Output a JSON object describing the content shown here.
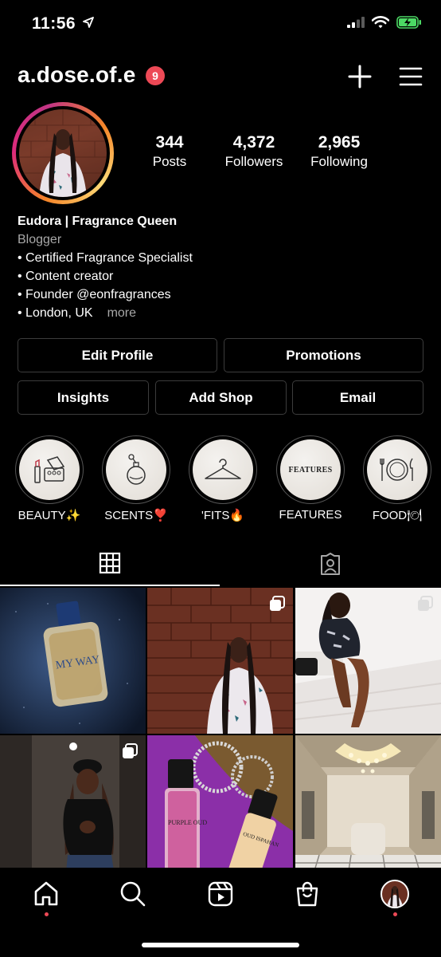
{
  "status_bar": {
    "time": "11:56"
  },
  "header": {
    "username": "a.dose.of.e",
    "notification_count": "9"
  },
  "stats": [
    {
      "value": "344",
      "label": "Posts"
    },
    {
      "value": "4,372",
      "label": "Followers"
    },
    {
      "value": "2,965",
      "label": "Following"
    }
  ],
  "bio": {
    "name": "Eudora | Fragrance Queen",
    "category": "Blogger",
    "lines": [
      "• Certified Fragrance Specialist",
      "• Content creator",
      "• Founder @eonfragrances",
      "• London, UK"
    ],
    "more": "more"
  },
  "buttons": {
    "edit_profile": "Edit Profile",
    "promotions": "Promotions",
    "insights": "Insights",
    "add_shop": "Add Shop",
    "email": "Email"
  },
  "highlights": [
    {
      "label": "BEAUTY✨",
      "icon": "makeup-palette-icon"
    },
    {
      "label": "SCENTS❣️",
      "icon": "perfume-bottle-icon"
    },
    {
      "label": "'FITS🔥",
      "icon": "hanger-icon"
    },
    {
      "label": "FEATURES",
      "icon": "features-text",
      "cover_text": "FEATURES"
    },
    {
      "label": "FOOD🍽",
      "icon": "plate-cutlery-icon"
    }
  ],
  "tabs": [
    {
      "name": "grid",
      "icon": "grid-icon",
      "active": true
    },
    {
      "name": "tagged",
      "icon": "tagged-person-icon",
      "active": false
    }
  ],
  "posts": [
    {
      "subject": "perfume bottle on sparkly fabric",
      "multiple": false,
      "bottle_text": "MY WAY"
    },
    {
      "subject": "woman in floral shirt against brick wall",
      "multiple": true
    },
    {
      "subject": "woman sitting on white stairs",
      "multiple": true
    },
    {
      "subject": "mirror selfie in black outfit and cap",
      "multiple": true
    },
    {
      "subject": "two perfume bottles on purple with jewelry",
      "multiple": false,
      "bottle_text_1": "PURPLE OUD",
      "bottle_text_2": "OUD ISPAHAN"
    },
    {
      "subject": "chandelier hall interior",
      "multiple": false
    }
  ],
  "bottom_nav": [
    "home-icon",
    "search-icon",
    "reels-icon",
    "shop-icon",
    "profile-avatar"
  ],
  "colors": {
    "background": "#000000",
    "badge": "#ed4956",
    "border": "#3c3c3c",
    "secondary_text": "#a8a8a8",
    "battery": "#4cd964"
  }
}
